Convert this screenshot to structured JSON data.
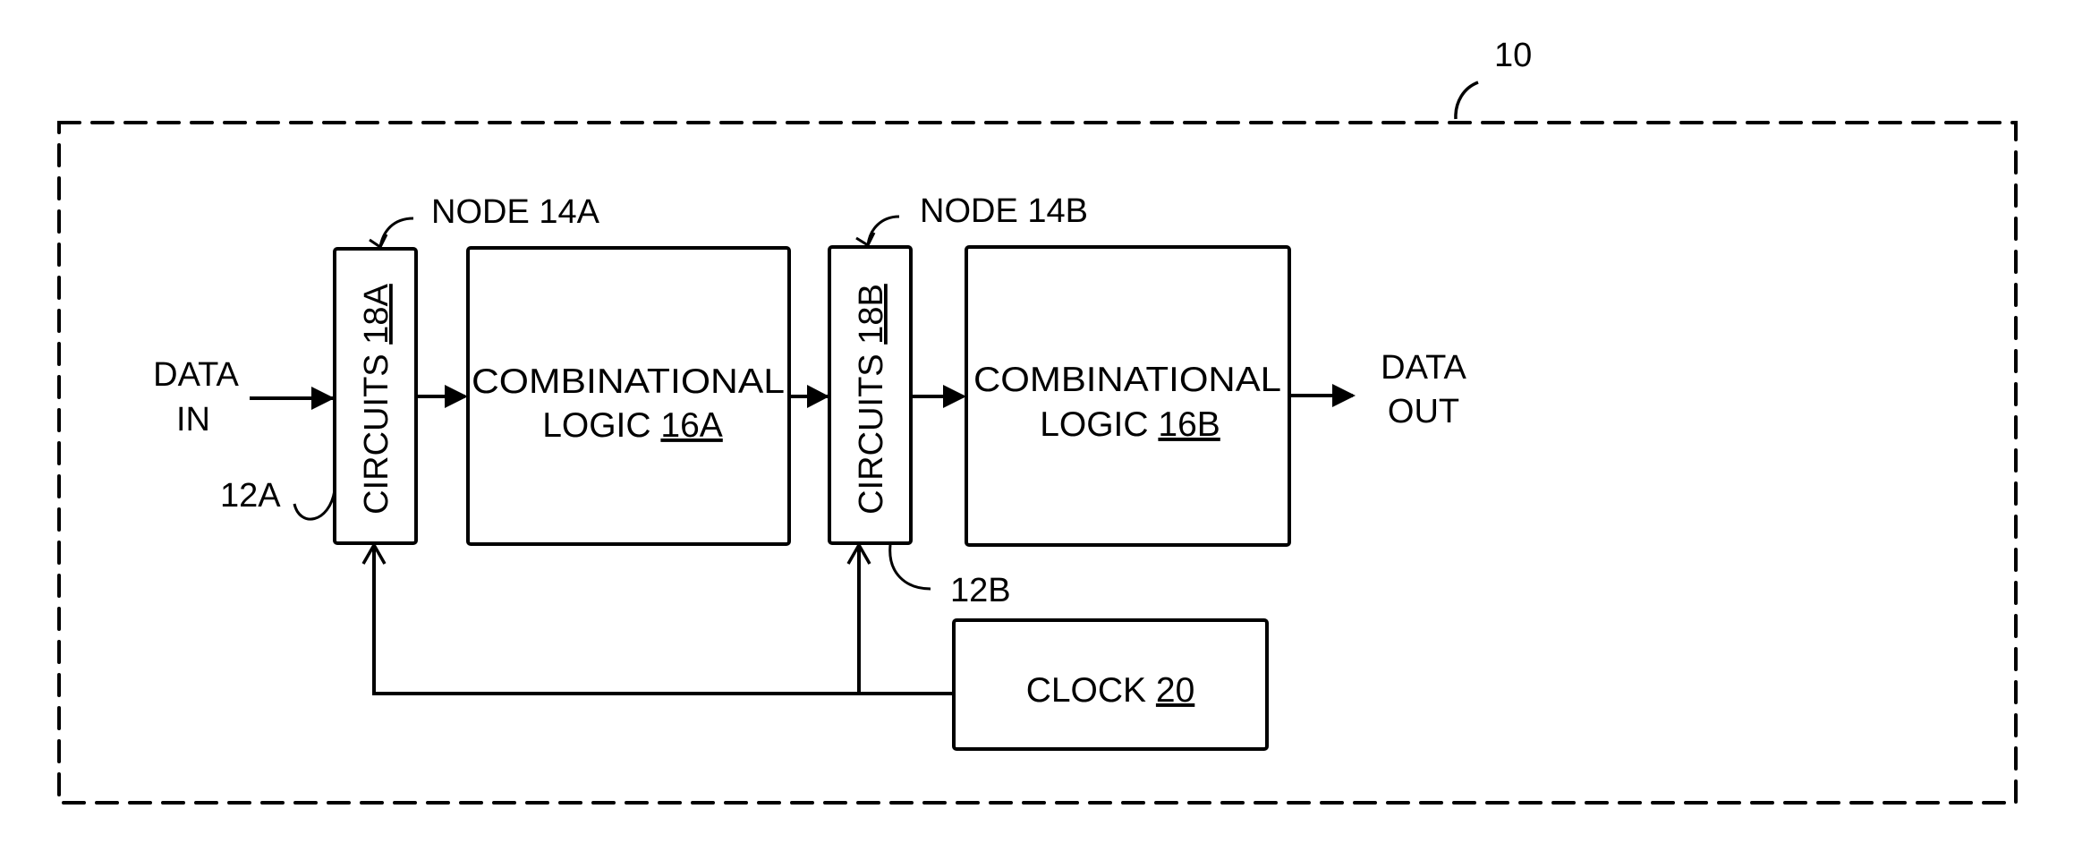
{
  "figure": {
    "reference_numeral": "10",
    "colors": {
      "stroke": "#000000",
      "background": "#ffffff"
    }
  },
  "nodes": [
    {
      "id": "14A",
      "label": "NODE 14A"
    },
    {
      "id": "14B",
      "label": "NODE 14B"
    }
  ],
  "circuits": [
    {
      "id": "18A",
      "text": "CIRCUITS ",
      "ref": "18A",
      "group_label": "12A"
    },
    {
      "id": "18B",
      "text": "CIRCUITS ",
      "ref": "18B",
      "group_label": "12B"
    }
  ],
  "logic": [
    {
      "id": "16A",
      "line1": "COMBINATIONAL",
      "line2": "LOGIC ",
      "ref": "16A"
    },
    {
      "id": "16B",
      "line1": "COMBINATIONAL",
      "line2": "LOGIC ",
      "ref": "16B"
    }
  ],
  "clock": {
    "text": "CLOCK ",
    "ref": "20"
  },
  "io": {
    "input_line1": "DATA",
    "input_line2": "IN",
    "output_line1": "DATA",
    "output_line2": "OUT"
  }
}
